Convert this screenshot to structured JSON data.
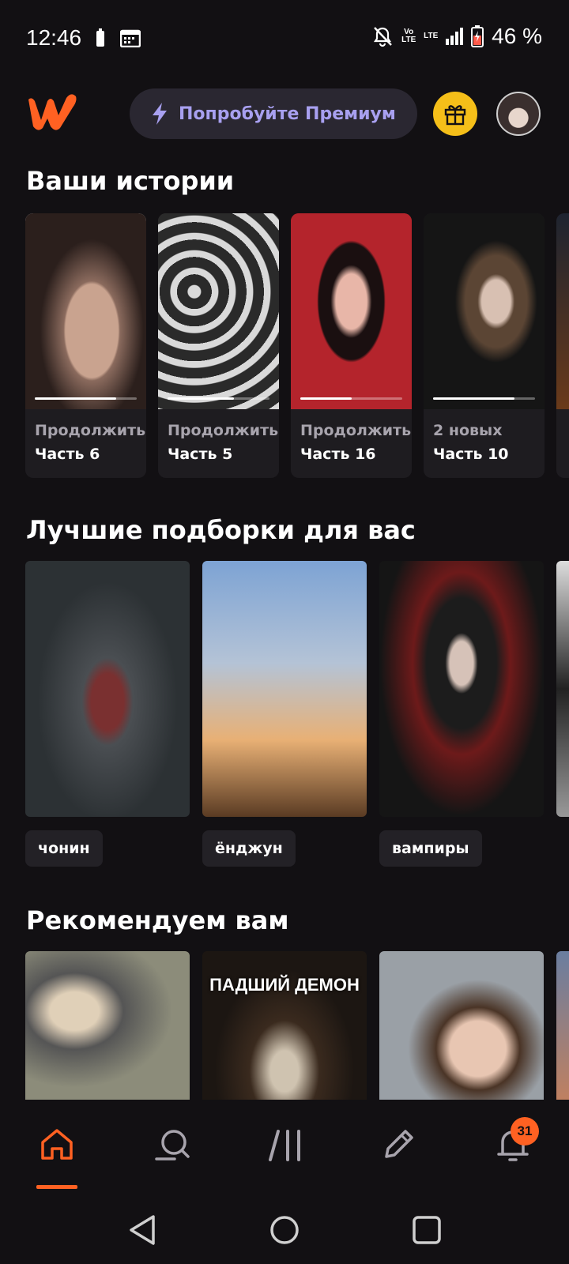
{
  "status_bar": {
    "time": "12:46",
    "battery_percent": "46 %",
    "net_label_1": "Vo LTE",
    "net_label_2": "LTE"
  },
  "header": {
    "premium_label": "Попробуйте Премиум",
    "accent_color": "#ff6122"
  },
  "your_stories": {
    "title": "Ваши истории",
    "items": [
      {
        "status": "Продолжить",
        "part": "Часть 6",
        "progress": 0.8
      },
      {
        "status": "Продолжить",
        "part": "Часть 5",
        "progress": 0.65
      },
      {
        "status": "Продолжить",
        "part": "Часть 16",
        "progress": 0.5
      },
      {
        "status": "2 новых",
        "part": "Часть 10",
        "progress": 0.8
      }
    ]
  },
  "collections": {
    "title": "Лучшие подборки для вас",
    "items": [
      {
        "tag": "чонин"
      },
      {
        "tag": "ёнджун"
      },
      {
        "tag": "вампиры"
      }
    ]
  },
  "recommended": {
    "title": "Рекомендуем вам",
    "items": [
      {
        "cover_text": ""
      },
      {
        "cover_text": "ПАДШИЙ ДЕМОН"
      },
      {
        "cover_text": ""
      }
    ]
  },
  "bottom_nav": {
    "notifications_badge": "31",
    "items": [
      "home-icon",
      "search-icon",
      "library-icon",
      "write-icon",
      "bell-icon"
    ]
  }
}
